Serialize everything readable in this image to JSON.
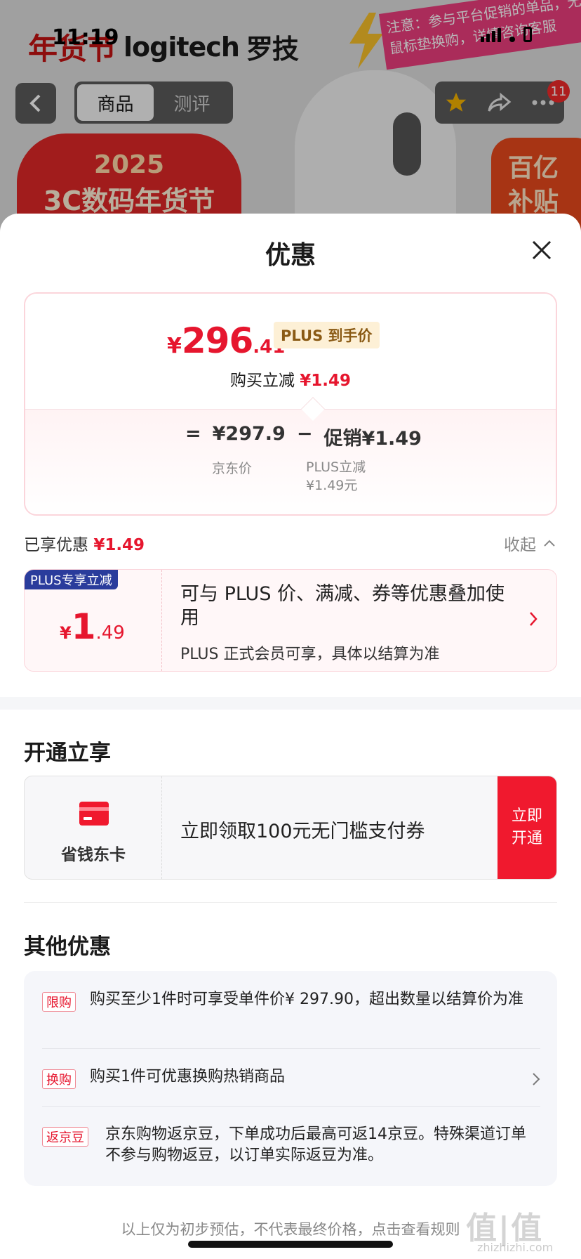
{
  "status_bar": {
    "time": "11:19"
  },
  "background": {
    "festival_logo": "年货节",
    "brand_en": "logitech",
    "brand_cn": "罗技",
    "notice": "注意：参与平台促销的单品，无法鼠标垫换购，详情咨询客服",
    "tabs": [
      "商品",
      "测评"
    ],
    "cart_badge": "11",
    "promo_line1": "2025",
    "promo_line2": "3C数码年货节",
    "subsidy_line1": "百亿",
    "subsidy_line2": "补贴"
  },
  "sheet": {
    "title": "优惠",
    "price_card": {
      "currency": "¥",
      "price_int": "296",
      "price_dec": ".41",
      "plus_tag": "PLUS 到手价",
      "reduce_label": "购买立减",
      "reduce_value": "¥1.49",
      "eq": "=",
      "jd_price": "¥297.9",
      "minus": "−",
      "promo_label": "促销",
      "promo_value": "¥1.49",
      "jd_price_label": "京东价",
      "plus_reduce_label": "PLUS立减",
      "plus_reduce_value": "¥1.49元"
    },
    "enjoyed_label": "已享优惠",
    "enjoyed_value": "¥1.49",
    "collapse_label": "收起",
    "plus_offer": {
      "label": "PLUS专享立减",
      "currency": "¥",
      "amount_int": "1",
      "amount_dec": ".49",
      "desc": "可与 PLUS 价、满减、券等优惠叠加使用",
      "sub": "PLUS 正式会员可享，具体以结算为准"
    },
    "open_section": {
      "title": "开通立享",
      "card_name": "省钱东卡",
      "card_text": "立即领取100元无门槛支付券",
      "button": "立即开通"
    },
    "other_section": {
      "title": "其他优惠",
      "items": [
        {
          "tag": "限购",
          "text": "购买至少1件时可享受单件价¥ 297.90，超出数量以结算价为准"
        },
        {
          "tag": "换购",
          "text": "购买1件可优惠换购热销商品"
        },
        {
          "tag": "返京豆",
          "text": "京东购物返京豆，下单成功后最高可返14京豆。特殊渠道订单不参与购物返豆，以订单实际返豆为准。"
        }
      ]
    },
    "footer_note": "以上仅为初步预估，不代表最终价格，点击查看规则",
    "watermark": "值|值",
    "watermark_sub": "zhizhizhi.com"
  },
  "colors": {
    "accent": "#e6162e",
    "plus_blue": "#2a3c9c",
    "button_red": "#f0192e"
  }
}
